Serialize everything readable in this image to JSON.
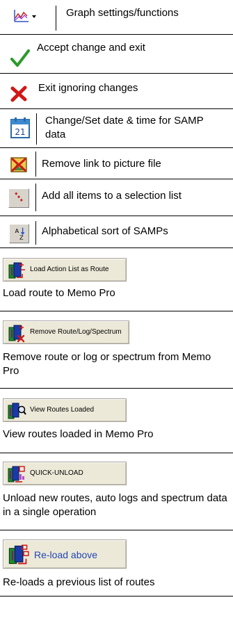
{
  "items": [
    {
      "label": "Graph settings/functions",
      "icon": "graph-settings-icon"
    },
    {
      "label": "Accept change and exit",
      "icon": "checkmark-icon"
    },
    {
      "label": "Exit ignoring changes",
      "icon": "red-x-icon"
    },
    {
      "label": "Change/Set date & time for SAMP data",
      "icon": "calendar-icon",
      "icon_text": "21"
    },
    {
      "label": "Remove link to picture file",
      "icon": "remove-picture-icon"
    },
    {
      "label": "Add all items to a selection list",
      "icon": "add-all-icon"
    },
    {
      "label": "Alphabetical sort of SAMPs",
      "icon": "sort-az-icon",
      "icon_text_top": "A",
      "icon_text_bottom": "Z"
    }
  ],
  "buttons": [
    {
      "button_label": "Load Action List as Route",
      "description": "Load route to Memo Pro",
      "icon": "load-route-icon"
    },
    {
      "button_label": "Remove Route/Log/Spectrum",
      "description": "Remove route or log or spectrum from Memo Pro",
      "icon": "remove-route-icon"
    },
    {
      "button_label": "View Routes Loaded",
      "description": "View routes loaded in Memo Pro",
      "icon": "view-routes-icon"
    },
    {
      "button_label": "QUICK-UNLOAD",
      "description": "Unload new routes, auto logs and spectrum data in a single operation",
      "icon": "quick-unload-icon"
    },
    {
      "button_label": "Re-load above",
      "description": "Re-loads a previous list of routes",
      "icon": "reload-icon"
    }
  ],
  "colors": {
    "button_face": "#ece9d8",
    "accent_blue": "#1f4fd0",
    "reload_text": "#2346b5"
  }
}
